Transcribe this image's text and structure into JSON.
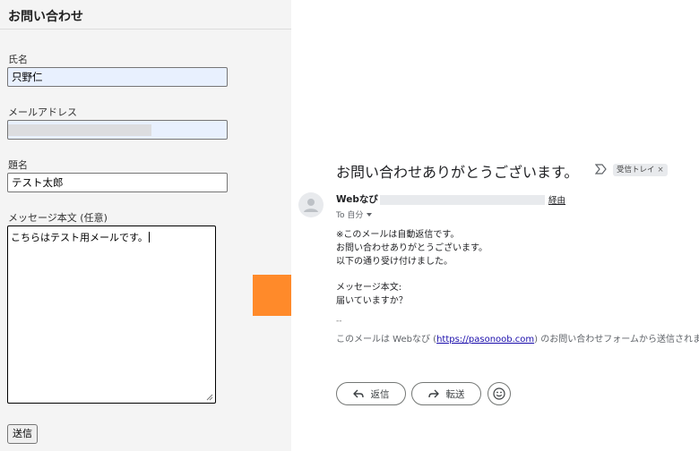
{
  "form": {
    "title": "お問い合わせ",
    "name_label": "氏名",
    "name_value": "只野仁",
    "email_label": "メールアドレス",
    "email_value": "",
    "subject_label": "題名",
    "subject_value": "テスト太郎",
    "message_label": "メッセージ本文 (任意)",
    "message_value": "こちらはテスト用メールです。",
    "submit_label": "送信"
  },
  "arrow": {
    "color": "#ff8a2a"
  },
  "email": {
    "subject": "お問い合わせありがとうございます。",
    "label_chip": "受信トレイ",
    "label_chip_close": "×",
    "sender_name": "Webなび",
    "via_text": "経由",
    "to_line": "To 自分",
    "body_lines": [
      "※このメールは自動返信です。",
      "お問い合わせありがとうございます。",
      "以下の通り受け付けました。",
      "メッセージ本文:",
      "届いていますか？"
    ],
    "signature_dash": "--",
    "footer_prefix": "このメールは Webなび (",
    "footer_link": "https://pasonoob.com",
    "footer_suffix": ") のお問い合わせフォームから送信されました",
    "reply_label": "返信",
    "forward_label": "転送"
  }
}
